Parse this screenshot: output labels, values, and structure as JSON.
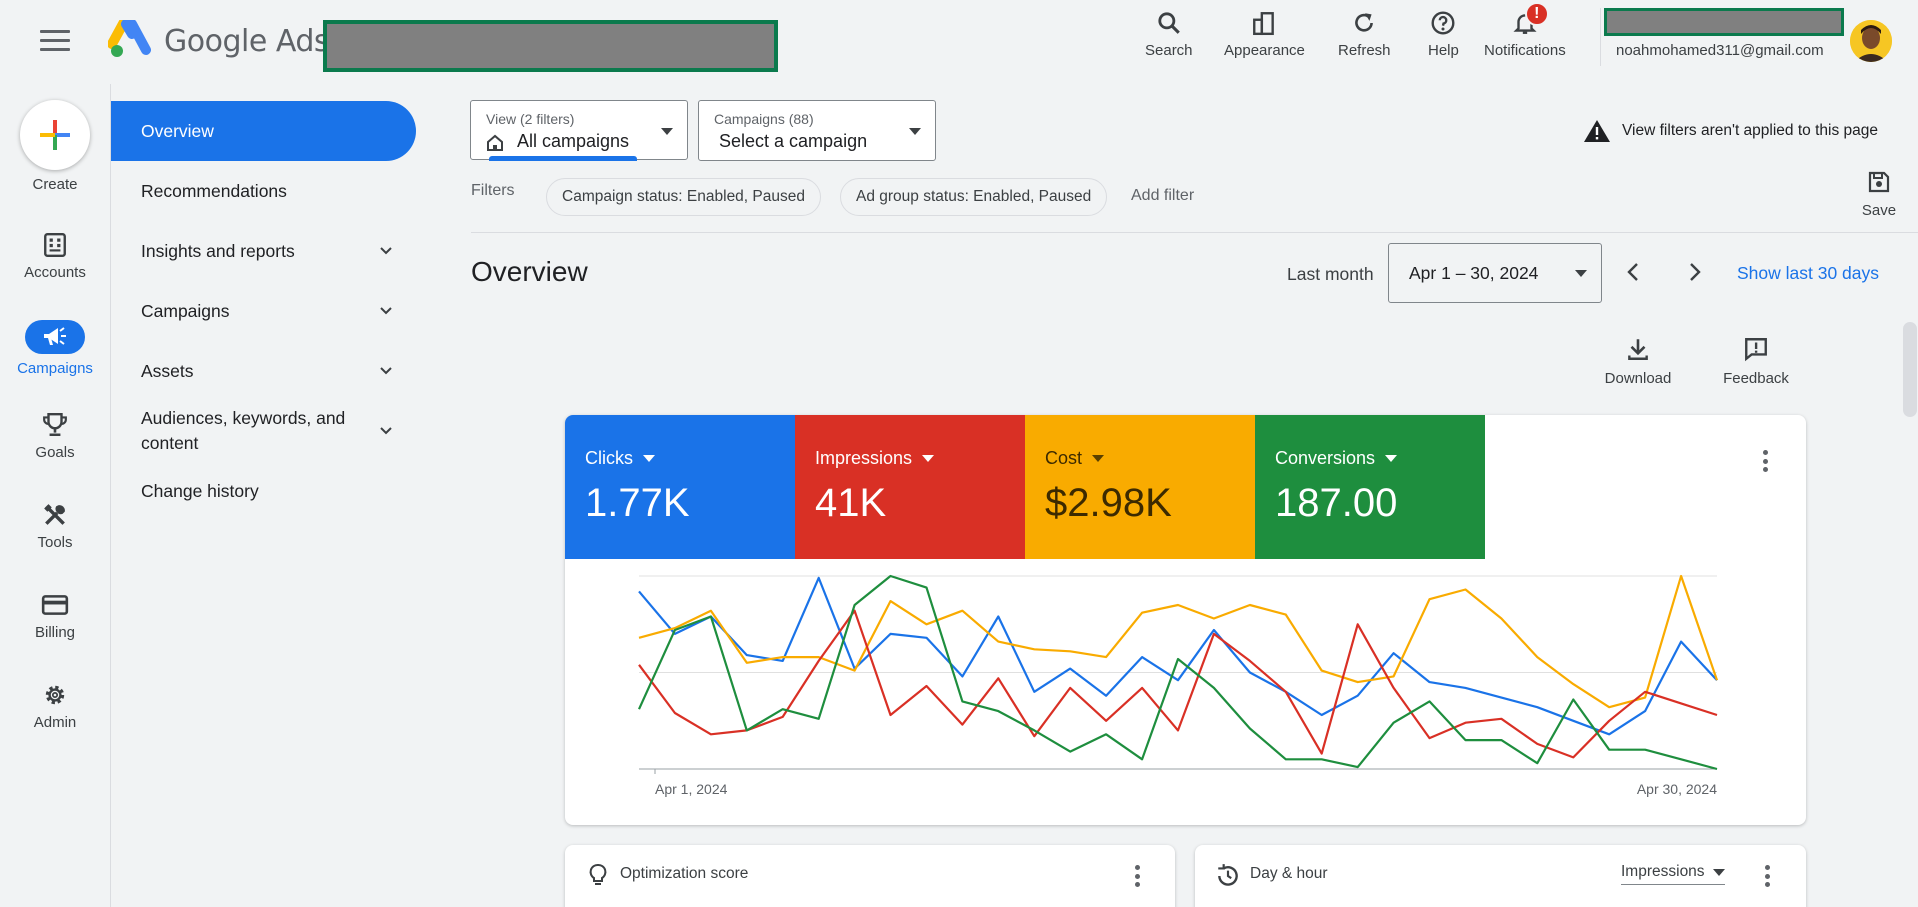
{
  "header": {
    "brand": "Google Ads",
    "buttons": {
      "search": "Search",
      "appearance": "Appearance",
      "refresh": "Refresh",
      "help": "Help",
      "notifications": "Notifications"
    },
    "notification_badge": "!",
    "email": "noahmohamed311@gmail.com"
  },
  "rail": {
    "create": "Create",
    "accounts": "Accounts",
    "campaigns": "Campaigns",
    "goals": "Goals",
    "tools": "Tools",
    "billing": "Billing",
    "admin": "Admin"
  },
  "nav": {
    "overview": "Overview",
    "recommendations": "Recommendations",
    "insights": "Insights and reports",
    "campaigns": "Campaigns",
    "assets": "Assets",
    "audiences_1": "Audiences, keywords, and",
    "audiences_2": "content",
    "change_history": "Change history"
  },
  "filters": {
    "view_small": "View (2 filters)",
    "view_big": "All campaigns",
    "campaigns_small": "Campaigns (88)",
    "campaigns_big": "Select a campaign",
    "warning": "View filters aren't applied to this page",
    "label": "Filters",
    "chip1": "Campaign status: Enabled, Paused",
    "chip2": "Ad group status: Enabled, Paused",
    "add": "Add filter",
    "save": "Save"
  },
  "overview": {
    "title": "Overview",
    "range_label": "Last month",
    "range": "Apr 1 – 30, 2024",
    "show_last": "Show last 30 days",
    "download": "Download",
    "feedback": "Feedback"
  },
  "metrics": {
    "clicks": {
      "label": "Clicks",
      "value": "1.77K"
    },
    "impressions": {
      "label": "Impressions",
      "value": "41K"
    },
    "cost": {
      "label": "Cost",
      "value": "$2.98K"
    },
    "conversions": {
      "label": "Conversions",
      "value": "187.00"
    }
  },
  "colors": {
    "blue": "#1a73e8",
    "red": "#d93025",
    "yellow": "#f9ab00",
    "green": "#1e8e3e"
  },
  "chart_data": {
    "type": "line",
    "x_start_label": "Apr 1, 2024",
    "x_end_label": "Apr 30, 2024",
    "x": [
      1,
      2,
      3,
      4,
      5,
      6,
      7,
      8,
      9,
      10,
      11,
      12,
      13,
      14,
      15,
      16,
      17,
      18,
      19,
      20,
      21,
      22,
      23,
      24,
      25,
      26,
      27,
      28,
      29,
      30
    ],
    "ylim": [
      0,
      100
    ],
    "grid": true,
    "series": [
      {
        "color": "#1a73e8",
        "values": [
          92,
          70,
          79,
          59,
          56,
          99,
          52,
          70,
          68,
          48,
          79,
          40,
          52,
          38,
          58,
          46,
          72,
          50,
          40,
          28,
          38,
          60,
          45,
          42,
          37,
          32,
          25,
          18,
          30,
          66,
          46
        ]
      },
      {
        "color": "#f9ab00",
        "values": [
          68,
          73,
          82,
          55,
          58,
          58,
          51,
          87,
          75,
          82,
          66,
          62,
          61,
          58,
          81,
          85,
          78,
          85,
          80,
          51,
          45,
          48,
          88,
          93,
          78,
          58,
          44,
          32,
          37,
          100,
          46
        ]
      },
      {
        "color": "#d93025",
        "values": [
          54,
          29,
          18,
          20,
          27,
          56,
          82,
          28,
          43,
          23,
          47,
          17,
          42,
          25,
          42,
          20,
          70,
          56,
          40,
          8,
          75,
          42,
          16,
          24,
          26,
          13,
          6,
          25,
          40,
          34,
          28
        ]
      },
      {
        "color": "#1e8e3e",
        "values": [
          31,
          72,
          79,
          20,
          31,
          26,
          85,
          100,
          94,
          35,
          30,
          20,
          9,
          18,
          5,
          57,
          42,
          21,
          5,
          5,
          1,
          24,
          35,
          15,
          15,
          3,
          36,
          10,
          10,
          5,
          0
        ]
      }
    ]
  },
  "cards": {
    "optimization": "Optimization score",
    "dayhour": "Day & hour",
    "dayhour_select": "Impressions"
  }
}
